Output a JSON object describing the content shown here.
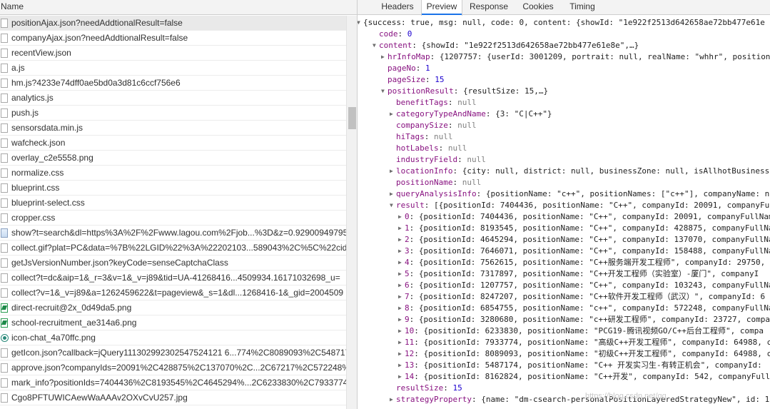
{
  "left": {
    "header": "Name",
    "requests": [
      {
        "name": "positionAjax.json?needAddtionalResult=false",
        "icon": "file-icon",
        "selected": true
      },
      {
        "name": "companyAjax.json?needAddtionalResult=false",
        "icon": "file-icon"
      },
      {
        "name": "recentView.json",
        "icon": "file-icon"
      },
      {
        "name": "a.js",
        "icon": "file-icon"
      },
      {
        "name": "hm.js?4233e74dff0ae5bd0a3d81c6ccf756e6",
        "icon": "file-icon"
      },
      {
        "name": "analytics.js",
        "icon": "file-icon"
      },
      {
        "name": "push.js",
        "icon": "file-icon"
      },
      {
        "name": "sensorsdata.min.js",
        "icon": "file-icon"
      },
      {
        "name": "wafcheck.json",
        "icon": "file-icon"
      },
      {
        "name": "overlay_c2e5558.png",
        "icon": "file-icon"
      },
      {
        "name": "normalize.css",
        "icon": "file-icon"
      },
      {
        "name": "blueprint.css",
        "icon": "file-icon"
      },
      {
        "name": "blueprint-select.css",
        "icon": "file-icon"
      },
      {
        "name": "cropper.css",
        "icon": "file-icon"
      },
      {
        "name": "show?t=search&dl=https%3A%2F%2Fwww.lagou.com%2Fjob...%3D&z=0.929009497958",
        "icon": "image-icon"
      },
      {
        "name": "collect.gif?plat=PC&data=%7B%22LGID%22%3A%22202103...589043%2C%5C%22cids%",
        "icon": "file-icon"
      },
      {
        "name": "getJsVersionNumber.json?keyCode=senseCaptchaClass",
        "icon": "file-icon"
      },
      {
        "name": "collect?t=dc&aip=1&_r=3&v=1&_v=j89&tid=UA-41268416...4509934.16171032698_u=",
        "icon": "file-icon"
      },
      {
        "name": "collect?v=1&_v=j89&a=1262459622&t=pageview&_s=1&dl...1268416-1&_gid=2004509",
        "icon": "file-icon"
      },
      {
        "name": "direct-recruit@2x_0d49da5.png",
        "icon": "png-icon"
      },
      {
        "name": "school-recruitment_ae314a6.png",
        "icon": "png-icon"
      },
      {
        "name": "icon-chat_4a70ffc.png",
        "icon": "chat-icon"
      },
      {
        "name": "getIcon.json?callback=jQuery111302992302547524121 6...774%2C8089093%2C5487174..",
        "icon": "file-icon"
      },
      {
        "name": "approve.json?companyIds=20091%2C428875%2C137070%2C...2C67217%2C572248%2C",
        "icon": "file-icon"
      },
      {
        "name": "mark_info?positionIds=7404436%2C8193545%2C4645294%...2C6233830%2C7933774%2",
        "icon": "file-icon"
      },
      {
        "name": "Cgo8PFTUWICAewWaAAAv2OXvCvU257.jpg",
        "icon": "file-icon"
      }
    ]
  },
  "right": {
    "tabs": [
      {
        "label": "Headers",
        "active": false
      },
      {
        "label": "Preview",
        "active": true
      },
      {
        "label": "Response",
        "active": false
      },
      {
        "label": "Cookies",
        "active": false
      },
      {
        "label": "Timing",
        "active": false
      }
    ],
    "tree": [
      {
        "indent": 0,
        "arrow": "down",
        "parts": [
          [
            "p",
            "{success: true, msg: null, code: 0, content: {showId: \"1e922f2513d642658ae72bb477e61e"
          ]
        ]
      },
      {
        "indent": 1,
        "parts": [
          [
            "k",
            "code"
          ],
          [
            "p",
            ": "
          ],
          [
            "n",
            "0"
          ]
        ]
      },
      {
        "indent": 1,
        "arrow": "down",
        "parts": [
          [
            "k",
            "content"
          ],
          [
            "p",
            ": {showId: \"1e922f2513d642658ae72bb477e61e8e\",…}"
          ]
        ]
      },
      {
        "indent": 2,
        "arrow": "right",
        "parts": [
          [
            "k",
            "hrInfoMap"
          ],
          [
            "p",
            ": {1207757: {userId: 3001209, portrait: null, realName: \"whhr\", positionN"
          ]
        ]
      },
      {
        "indent": 2,
        "parts": [
          [
            "k",
            "pageNo"
          ],
          [
            "p",
            ": "
          ],
          [
            "n",
            "1"
          ]
        ]
      },
      {
        "indent": 2,
        "parts": [
          [
            "k",
            "pageSize"
          ],
          [
            "p",
            ": "
          ],
          [
            "n",
            "15"
          ]
        ]
      },
      {
        "indent": 2,
        "arrow": "down",
        "parts": [
          [
            "k",
            "positionResult"
          ],
          [
            "p",
            ": {resultSize: 15,…}"
          ]
        ]
      },
      {
        "indent": 3,
        "parts": [
          [
            "k",
            "benefitTags"
          ],
          [
            "p",
            ": "
          ],
          [
            "nul",
            "null"
          ]
        ]
      },
      {
        "indent": 3,
        "arrow": "right",
        "parts": [
          [
            "k",
            "categoryTypeAndName"
          ],
          [
            "p",
            ": {3: \"C|C++\"}"
          ]
        ]
      },
      {
        "indent": 3,
        "parts": [
          [
            "k",
            "companySize"
          ],
          [
            "p",
            ": "
          ],
          [
            "nul",
            "null"
          ]
        ]
      },
      {
        "indent": 3,
        "parts": [
          [
            "k",
            "hiTags"
          ],
          [
            "p",
            ": "
          ],
          [
            "nul",
            "null"
          ]
        ]
      },
      {
        "indent": 3,
        "parts": [
          [
            "k",
            "hotLabels"
          ],
          [
            "p",
            ": "
          ],
          [
            "nul",
            "null"
          ]
        ]
      },
      {
        "indent": 3,
        "parts": [
          [
            "k",
            "industryField"
          ],
          [
            "p",
            ": "
          ],
          [
            "nul",
            "null"
          ]
        ]
      },
      {
        "indent": 3,
        "arrow": "right",
        "parts": [
          [
            "k",
            "locationInfo"
          ],
          [
            "p",
            ": {city: null, district: null, businessZone: null, isAllhotBusinessZ"
          ]
        ]
      },
      {
        "indent": 3,
        "parts": [
          [
            "k",
            "positionName"
          ],
          [
            "p",
            ": "
          ],
          [
            "nul",
            "null"
          ]
        ]
      },
      {
        "indent": 3,
        "arrow": "right",
        "parts": [
          [
            "k",
            "queryAnalysisInfo"
          ],
          [
            "p",
            ": {positionName: \"c++\", positionNames: [\"c++\"], companyName: nu"
          ]
        ]
      },
      {
        "indent": 3,
        "arrow": "down",
        "parts": [
          [
            "k",
            "result"
          ],
          [
            "p",
            ": [{positionId: 7404436, positionName: \"C++\", companyId: 20091, companyFul"
          ]
        ]
      },
      {
        "indent": 4,
        "arrow": "right",
        "parts": [
          [
            "k",
            "0"
          ],
          [
            "p",
            ": {positionId: 7404436, positionName: \"C++\", companyId: 20091, companyFullNam"
          ]
        ]
      },
      {
        "indent": 4,
        "arrow": "right",
        "parts": [
          [
            "k",
            "1"
          ],
          [
            "p",
            ": {positionId: 8193545, positionName: \"C++\", companyId: 428875, companyFullNa"
          ]
        ]
      },
      {
        "indent": 4,
        "arrow": "right",
        "parts": [
          [
            "k",
            "2"
          ],
          [
            "p",
            ": {positionId: 4645294, positionName: \"C++\", companyId: 137070, companyFullNa"
          ]
        ]
      },
      {
        "indent": 4,
        "arrow": "right",
        "parts": [
          [
            "k",
            "3"
          ],
          [
            "p",
            ": {positionId: 7646071, positionName: \"C++\", companyId: 158488, companyFullNa"
          ]
        ]
      },
      {
        "indent": 4,
        "arrow": "right",
        "parts": [
          [
            "k",
            "4"
          ],
          [
            "p",
            ": {positionId: 7562615, positionName: \"C++服务端开发工程师\", companyId: 29750,"
          ]
        ]
      },
      {
        "indent": 4,
        "arrow": "right",
        "parts": [
          [
            "k",
            "5"
          ],
          [
            "p",
            ": {positionId: 7317897, positionName: \"C++开发工程师（实验室）-厦门\", companyI"
          ]
        ]
      },
      {
        "indent": 4,
        "arrow": "right",
        "parts": [
          [
            "k",
            "6"
          ],
          [
            "p",
            ": {positionId: 1207757, positionName: \"C++\", companyId: 103243, companyFullNa"
          ]
        ]
      },
      {
        "indent": 4,
        "arrow": "right",
        "parts": [
          [
            "k",
            "7"
          ],
          [
            "p",
            ": {positionId: 8247207, positionName: \"C++软件开发工程师（武汉）\", companyId: 6"
          ]
        ]
      },
      {
        "indent": 4,
        "arrow": "right",
        "parts": [
          [
            "k",
            "8"
          ],
          [
            "p",
            ": {positionId: 6854755, positionName: \"c++\", companyId: 572248, companyFullNa"
          ]
        ]
      },
      {
        "indent": 4,
        "arrow": "right",
        "parts": [
          [
            "k",
            "9"
          ],
          [
            "p",
            ": {positionId: 3280680, positionName: \"c++研发工程师\", companyId: 23727, compa"
          ]
        ]
      },
      {
        "indent": 4,
        "arrow": "right",
        "parts": [
          [
            "k",
            "10"
          ],
          [
            "p",
            ": {positionId: 6233830, positionName: \"PCG19-腾讯视频GO/C++后台工程师\", compa"
          ]
        ]
      },
      {
        "indent": 4,
        "arrow": "right",
        "parts": [
          [
            "k",
            "11"
          ],
          [
            "p",
            ": {positionId: 7933774, positionName: \"高级C++开发工程师\", companyId: 64988, c"
          ]
        ]
      },
      {
        "indent": 4,
        "arrow": "right",
        "parts": [
          [
            "k",
            "12"
          ],
          [
            "p",
            ": {positionId: 8089093, positionName: \"初级C++开发工程师\", companyId: 64988, c"
          ]
        ]
      },
      {
        "indent": 4,
        "arrow": "right",
        "parts": [
          [
            "k",
            "13"
          ],
          [
            "p",
            ": {positionId: 5487174, positionName: \"C++ 开发实习生-有转正机会\", companyId:"
          ]
        ]
      },
      {
        "indent": 4,
        "arrow": "right",
        "parts": [
          [
            "k",
            "14"
          ],
          [
            "p",
            ": {positionId: 8162824, positionName: \"C++开发\", companyId: 542, companyFull"
          ]
        ]
      },
      {
        "indent": 3,
        "parts": [
          [
            "k",
            "resultSize"
          ],
          [
            "p",
            ": "
          ],
          [
            "n",
            "15"
          ]
        ]
      },
      {
        "indent": 3,
        "arrow": "right",
        "parts": [
          [
            "k",
            "strategyProperty"
          ],
          [
            "p",
            ": {name: \"dm-csearch-personalPositionLayeredStrategyNew\", id: 1"
          ]
        ]
      }
    ]
  },
  "watermark": "https://blog.csdn.net/qq..."
}
